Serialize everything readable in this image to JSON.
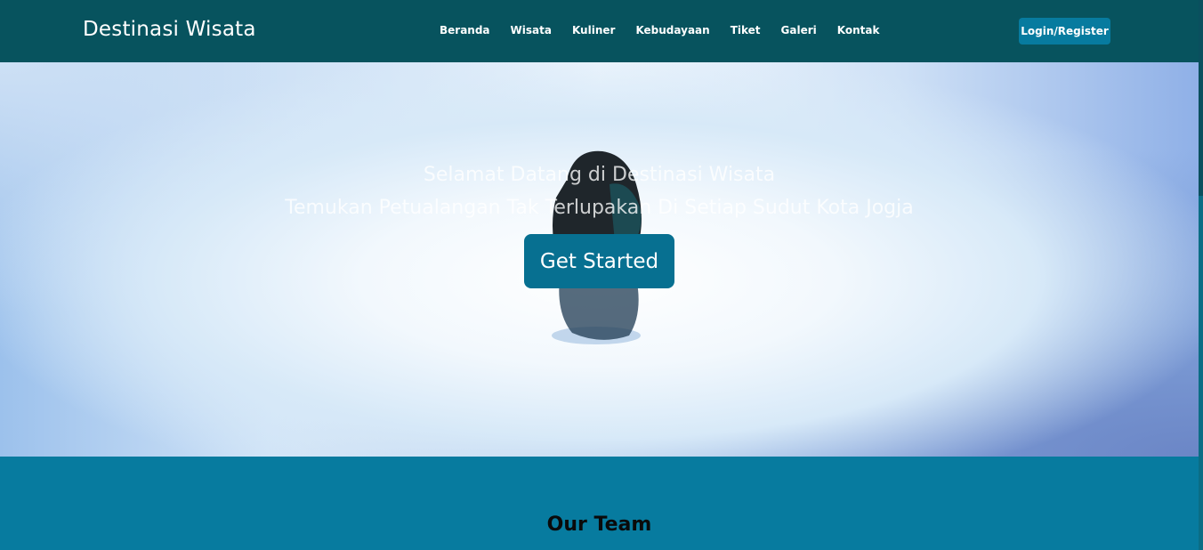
{
  "navbar": {
    "brand": "Destinasi Wisata",
    "menu": [
      "Beranda",
      "Wisata",
      "Kuliner",
      "Kebudayaan",
      "Tiket",
      "Galeri",
      "Kontak"
    ],
    "login_label": "Login/Register"
  },
  "hero": {
    "title": "Selamat Datang di Destinasi Wisata",
    "subtitle": "Temukan Petualangan Tak Terlupakan Di Setiap Sudut Kota Jogja",
    "cta_label": "Get Started"
  },
  "team": {
    "title": "Our Team"
  },
  "colors": {
    "navbar_bg": "#07535e",
    "accent": "#077b9f",
    "button": "#077091"
  }
}
